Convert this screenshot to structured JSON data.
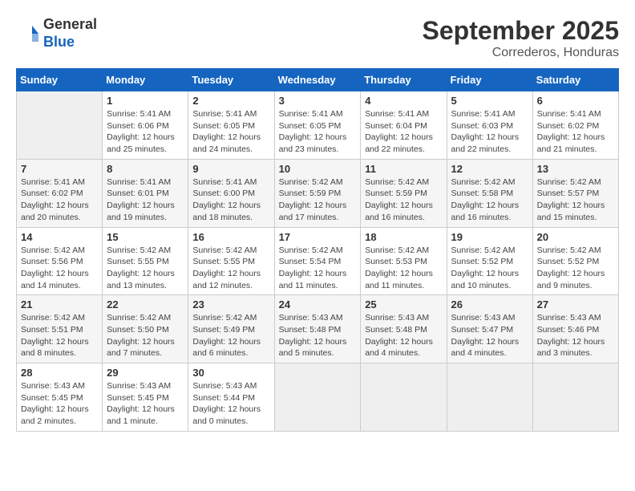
{
  "header": {
    "logo_line1": "General",
    "logo_line2": "Blue",
    "month": "September 2025",
    "location": "Correderos, Honduras"
  },
  "days_of_week": [
    "Sunday",
    "Monday",
    "Tuesday",
    "Wednesday",
    "Thursday",
    "Friday",
    "Saturday"
  ],
  "weeks": [
    [
      {
        "day": "",
        "text": ""
      },
      {
        "day": "1",
        "text": "Sunrise: 5:41 AM\nSunset: 6:06 PM\nDaylight: 12 hours\nand 25 minutes."
      },
      {
        "day": "2",
        "text": "Sunrise: 5:41 AM\nSunset: 6:05 PM\nDaylight: 12 hours\nand 24 minutes."
      },
      {
        "day": "3",
        "text": "Sunrise: 5:41 AM\nSunset: 6:05 PM\nDaylight: 12 hours\nand 23 minutes."
      },
      {
        "day": "4",
        "text": "Sunrise: 5:41 AM\nSunset: 6:04 PM\nDaylight: 12 hours\nand 22 minutes."
      },
      {
        "day": "5",
        "text": "Sunrise: 5:41 AM\nSunset: 6:03 PM\nDaylight: 12 hours\nand 22 minutes."
      },
      {
        "day": "6",
        "text": "Sunrise: 5:41 AM\nSunset: 6:02 PM\nDaylight: 12 hours\nand 21 minutes."
      }
    ],
    [
      {
        "day": "7",
        "text": "Sunrise: 5:41 AM\nSunset: 6:02 PM\nDaylight: 12 hours\nand 20 minutes."
      },
      {
        "day": "8",
        "text": "Sunrise: 5:41 AM\nSunset: 6:01 PM\nDaylight: 12 hours\nand 19 minutes."
      },
      {
        "day": "9",
        "text": "Sunrise: 5:41 AM\nSunset: 6:00 PM\nDaylight: 12 hours\nand 18 minutes."
      },
      {
        "day": "10",
        "text": "Sunrise: 5:42 AM\nSunset: 5:59 PM\nDaylight: 12 hours\nand 17 minutes."
      },
      {
        "day": "11",
        "text": "Sunrise: 5:42 AM\nSunset: 5:59 PM\nDaylight: 12 hours\nand 16 minutes."
      },
      {
        "day": "12",
        "text": "Sunrise: 5:42 AM\nSunset: 5:58 PM\nDaylight: 12 hours\nand 16 minutes."
      },
      {
        "day": "13",
        "text": "Sunrise: 5:42 AM\nSunset: 5:57 PM\nDaylight: 12 hours\nand 15 minutes."
      }
    ],
    [
      {
        "day": "14",
        "text": "Sunrise: 5:42 AM\nSunset: 5:56 PM\nDaylight: 12 hours\nand 14 minutes."
      },
      {
        "day": "15",
        "text": "Sunrise: 5:42 AM\nSunset: 5:55 PM\nDaylight: 12 hours\nand 13 minutes."
      },
      {
        "day": "16",
        "text": "Sunrise: 5:42 AM\nSunset: 5:55 PM\nDaylight: 12 hours\nand 12 minutes."
      },
      {
        "day": "17",
        "text": "Sunrise: 5:42 AM\nSunset: 5:54 PM\nDaylight: 12 hours\nand 11 minutes."
      },
      {
        "day": "18",
        "text": "Sunrise: 5:42 AM\nSunset: 5:53 PM\nDaylight: 12 hours\nand 11 minutes."
      },
      {
        "day": "19",
        "text": "Sunrise: 5:42 AM\nSunset: 5:52 PM\nDaylight: 12 hours\nand 10 minutes."
      },
      {
        "day": "20",
        "text": "Sunrise: 5:42 AM\nSunset: 5:52 PM\nDaylight: 12 hours\nand 9 minutes."
      }
    ],
    [
      {
        "day": "21",
        "text": "Sunrise: 5:42 AM\nSunset: 5:51 PM\nDaylight: 12 hours\nand 8 minutes."
      },
      {
        "day": "22",
        "text": "Sunrise: 5:42 AM\nSunset: 5:50 PM\nDaylight: 12 hours\nand 7 minutes."
      },
      {
        "day": "23",
        "text": "Sunrise: 5:42 AM\nSunset: 5:49 PM\nDaylight: 12 hours\nand 6 minutes."
      },
      {
        "day": "24",
        "text": "Sunrise: 5:43 AM\nSunset: 5:48 PM\nDaylight: 12 hours\nand 5 minutes."
      },
      {
        "day": "25",
        "text": "Sunrise: 5:43 AM\nSunset: 5:48 PM\nDaylight: 12 hours\nand 4 minutes."
      },
      {
        "day": "26",
        "text": "Sunrise: 5:43 AM\nSunset: 5:47 PM\nDaylight: 12 hours\nand 4 minutes."
      },
      {
        "day": "27",
        "text": "Sunrise: 5:43 AM\nSunset: 5:46 PM\nDaylight: 12 hours\nand 3 minutes."
      }
    ],
    [
      {
        "day": "28",
        "text": "Sunrise: 5:43 AM\nSunset: 5:45 PM\nDaylight: 12 hours\nand 2 minutes."
      },
      {
        "day": "29",
        "text": "Sunrise: 5:43 AM\nSunset: 5:45 PM\nDaylight: 12 hours\nand 1 minute."
      },
      {
        "day": "30",
        "text": "Sunrise: 5:43 AM\nSunset: 5:44 PM\nDaylight: 12 hours\nand 0 minutes."
      },
      {
        "day": "",
        "text": ""
      },
      {
        "day": "",
        "text": ""
      },
      {
        "day": "",
        "text": ""
      },
      {
        "day": "",
        "text": ""
      }
    ]
  ]
}
